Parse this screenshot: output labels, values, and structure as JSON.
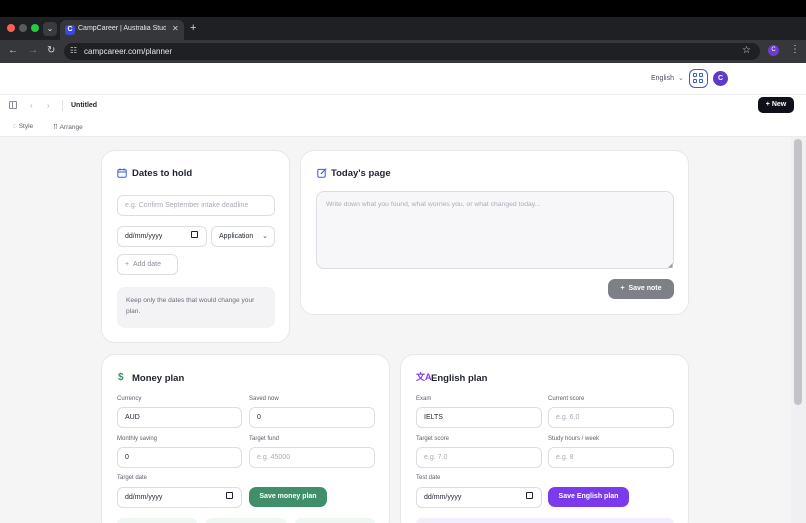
{
  "browser": {
    "tab_title": "CampCareer | Australia Study",
    "favicon_letter": "C",
    "url": "campcareer.com/planner",
    "profile_letter": "C"
  },
  "app": {
    "language": "English",
    "avatar_letter": "C",
    "doc_title": "Untitled",
    "new_label": "New",
    "toolbar": {
      "style": "Style",
      "arrange": "Arrange"
    }
  },
  "dates": {
    "title": "Dates to hold",
    "placeholder": "e.g. Confirm September intake deadline",
    "date_value": "dd/mm/yyyy",
    "type_select": "Application",
    "add_label": "Add date",
    "tip": "Keep only the dates that would change your plan."
  },
  "today": {
    "title": "Today's page",
    "placeholder": "Write down what you found, what worries you, or what changed today...",
    "save_label": "Save note"
  },
  "money": {
    "title": "Money plan",
    "currency_label": "Currency",
    "currency_value": "AUD",
    "saved_label": "Saved now",
    "saved_value": "0",
    "monthly_label": "Monthly saving",
    "monthly_value": "0",
    "target_label": "Target fund",
    "target_placeholder": "e.g. 45000",
    "date_label": "Target date",
    "date_value": "dd/mm/yyyy",
    "save_label": "Save money plan"
  },
  "english": {
    "title": "English plan",
    "exam_label": "Exam",
    "exam_value": "IELTS",
    "current_label": "Current score",
    "current_placeholder": "e.g. 6.0",
    "target_label": "Target score",
    "target_placeholder": "e.g. 7.0",
    "hours_label": "Study hours / week",
    "hours_placeholder": "e.g. 8",
    "date_label": "Test date",
    "date_value": "dd/mm/yyyy",
    "save_label": "Save English plan"
  },
  "colors": {
    "accent_blue": "#3b5bdb",
    "money_green": "#3f8f6a",
    "english_purple": "#7c3aed",
    "save_note_gray": "#7d8087"
  }
}
